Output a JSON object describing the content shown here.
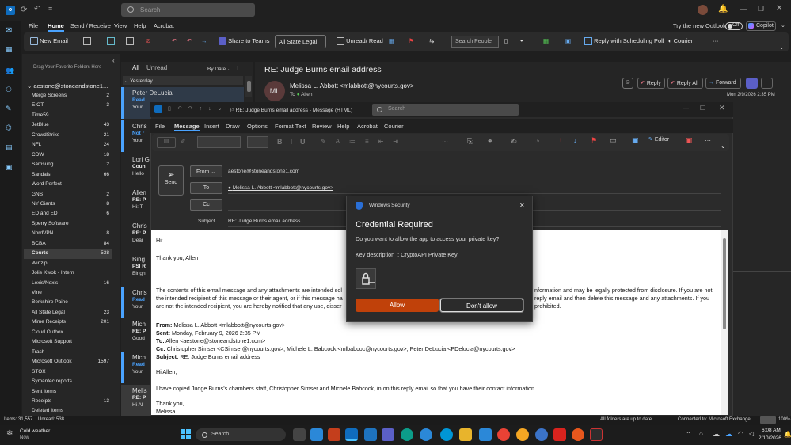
{
  "titlebar": {
    "search_placeholder": "Search",
    "try_outlook": "Try the new Outlook",
    "toggle_state": "Off",
    "copilot": "Copilot"
  },
  "menu": [
    "File",
    "Home",
    "Send / Receive",
    "View",
    "Help",
    "Acrobat"
  ],
  "ribbon": {
    "new_email": "New Email",
    "share_teams": "Share to Teams",
    "all_state_legal": "All State Legal",
    "unread_read": "Unread/ Read",
    "search_people": "Search People",
    "reply_poll": "Reply with Scheduling Poll",
    "courier": "Courier"
  },
  "folders": {
    "drag_hint": "Drag Your Favorite Folders Here",
    "account": "aestone@stoneandstone1...",
    "items": [
      {
        "name": "Merge Screens",
        "count": "2"
      },
      {
        "name": "EIOT",
        "count": "3"
      },
      {
        "name": "Time59",
        "count": ""
      },
      {
        "name": "JetBlue",
        "count": "43"
      },
      {
        "name": "CrowdStrike",
        "count": "21"
      },
      {
        "name": "NFL",
        "count": "24"
      },
      {
        "name": "CDW",
        "count": "18"
      },
      {
        "name": "Samsung",
        "count": "2"
      },
      {
        "name": "Sandals",
        "count": "66"
      },
      {
        "name": "Word Perfect",
        "count": ""
      },
      {
        "name": "GNS",
        "count": "2"
      },
      {
        "name": "NY Giants",
        "count": "8"
      },
      {
        "name": "ED and ED",
        "count": "6"
      },
      {
        "name": "Sperry Software",
        "count": ""
      },
      {
        "name": "NordVPN",
        "count": "8"
      },
      {
        "name": "BCBA",
        "count": "84"
      },
      {
        "name": "Courts",
        "count": "538"
      },
      {
        "name": "Winzip",
        "count": ""
      },
      {
        "name": "Jolie Kwok - Intern",
        "count": ""
      },
      {
        "name": "Lexis/Nexis",
        "count": "16"
      },
      {
        "name": "Vine",
        "count": ""
      },
      {
        "name": "Berkshire Paine",
        "count": ""
      },
      {
        "name": "All State Legal",
        "count": "23"
      },
      {
        "name": "Mime Receipts",
        "count": "201"
      },
      {
        "name": "Cloud Outbox",
        "count": ""
      },
      {
        "name": "Microsoft Support",
        "count": ""
      },
      {
        "name": "Trash",
        "count": ""
      },
      {
        "name": "Microsoft Outlook",
        "count": "1597"
      },
      {
        "name": "STOX",
        "count": ""
      },
      {
        "name": "Symantec reports",
        "count": ""
      },
      {
        "name": "Sent Items",
        "count": ""
      },
      {
        "name": "Receipts",
        "count": "13"
      },
      {
        "name": "Deleted Items",
        "count": ""
      }
    ]
  },
  "list": {
    "tab_all": "All",
    "tab_unread": "Unread",
    "sort": "By Date",
    "group": "Yesterday",
    "messages": [
      {
        "from": "Peter DeLucia",
        "l2": "Read",
        "l3": "Your"
      },
      {
        "from": "Chris",
        "l2": "Not r",
        "l3": "Your"
      },
      {
        "from": "Lori G",
        "l2": "Coun",
        "l3": "Hello"
      },
      {
        "from": "Allen",
        "l2": "RE: P",
        "l3": "Hi: T"
      },
      {
        "from": "Chris",
        "l2": "RE: P",
        "l3": "Dear"
      },
      {
        "from": "Bing",
        "l2": "PSI R",
        "l3": "Bingh"
      },
      {
        "from": "Chris",
        "l2": "Read",
        "l3": "Your"
      },
      {
        "from": "Mich",
        "l2": "RE: P",
        "l3": "Good"
      },
      {
        "from": "Mich",
        "l2": "Read",
        "l3": "Your"
      },
      {
        "from": "Melis",
        "l2": "RE: P",
        "l3": "Hi Al"
      }
    ]
  },
  "reading": {
    "subject": "RE: Judge Burns email address",
    "initials": "ML",
    "sender": "Melissa L. Abbott <mlabbott@nycourts.gov>",
    "to_label": "To",
    "to": "Allen",
    "date": "Mon 2/9/2026 2:35 PM",
    "reply": "Reply",
    "reply_all": "Reply All",
    "forward": "Forward"
  },
  "compose": {
    "title": "RE: Judge Burns email address - Message (HTML)",
    "search": "Search",
    "menu": [
      "File",
      "Message",
      "Insert",
      "Draw",
      "Options",
      "Format Text",
      "Review",
      "Help",
      "Acrobat",
      "Courier"
    ],
    "editor": "Editor",
    "send": "Send",
    "from_btn": "From",
    "from_addr": "aestone@stoneandstone1.com",
    "to_btn": "To",
    "to_addr": "Melissa L. Abbott <mlabbott@nycourts.gov>",
    "cc_btn": "Cc",
    "subject_label": "Subject",
    "subject": "RE: Judge Burns email address",
    "body": {
      "hi": "Hi:",
      "thanks": "Thank you, Allen",
      "disc1a": "The contents of this email message and any attachments are intended sol",
      "disc1b": "nformation and may be legally protected from disclosure. If you are not",
      "disc2a": "the intended recipient of this message or their agent, or if this message ha",
      "disc2b": "reply email and then delete this message and any attachments. If you",
      "disc3a": "are not the intended recipient, you are hereby notified that any use, disser",
      "disc3b": "prohibited.",
      "from_l": "From:",
      "from_v": " Melissa L. Abbott <mlabbott@nycourts.gov>",
      "sent_l": "Sent:",
      "sent_v": " Monday, February 9, 2026 2:35 PM",
      "to_l": "To:",
      "to_v": " Allen <aestone@stoneandstone1.com>",
      "cc_l": "Cc:",
      "cc_v": " Christopher Simser <CSimser@nycourts.gov>; Michele L. Babcock <mlbabcoc@nycourts.gov>; Peter DeLucia <PDelucia@nycourts.gov>",
      "subj_l": "Subject:",
      "subj_v": " RE: Judge Burns email address",
      "hi_allen": "Hi Allen,",
      "para": "I have copied Judge Burns’s chambers staff, Christopher Simser and Michele Babcock, in on this reply email so that you have their contact information.",
      "ty": "Thank you,",
      "sig": "Melissa"
    }
  },
  "dialog": {
    "app": "Windows Security",
    "title": "Credential Required",
    "question": "Do you want to allow the app to access your private key?",
    "key_desc": "Key description  : CryptoAPI Private Key",
    "allow": "Allow",
    "deny": "Don't allow"
  },
  "status": {
    "items": "Items: 31,557",
    "unread": "Unread: 538",
    "folders": "All folders are up to date.",
    "connected": "Connected to: Microsoft Exchange",
    "zoom": "100%"
  },
  "taskbar": {
    "weather_t": "Cold weather",
    "weather_s": "Now",
    "search": "Search",
    "time": "6:08 AM",
    "date": "2/10/2026"
  },
  "colors": {
    "accent": "#c0410a",
    "outlook_blue": "#0f6cbd",
    "unread_blue": "#4aa3ff"
  }
}
